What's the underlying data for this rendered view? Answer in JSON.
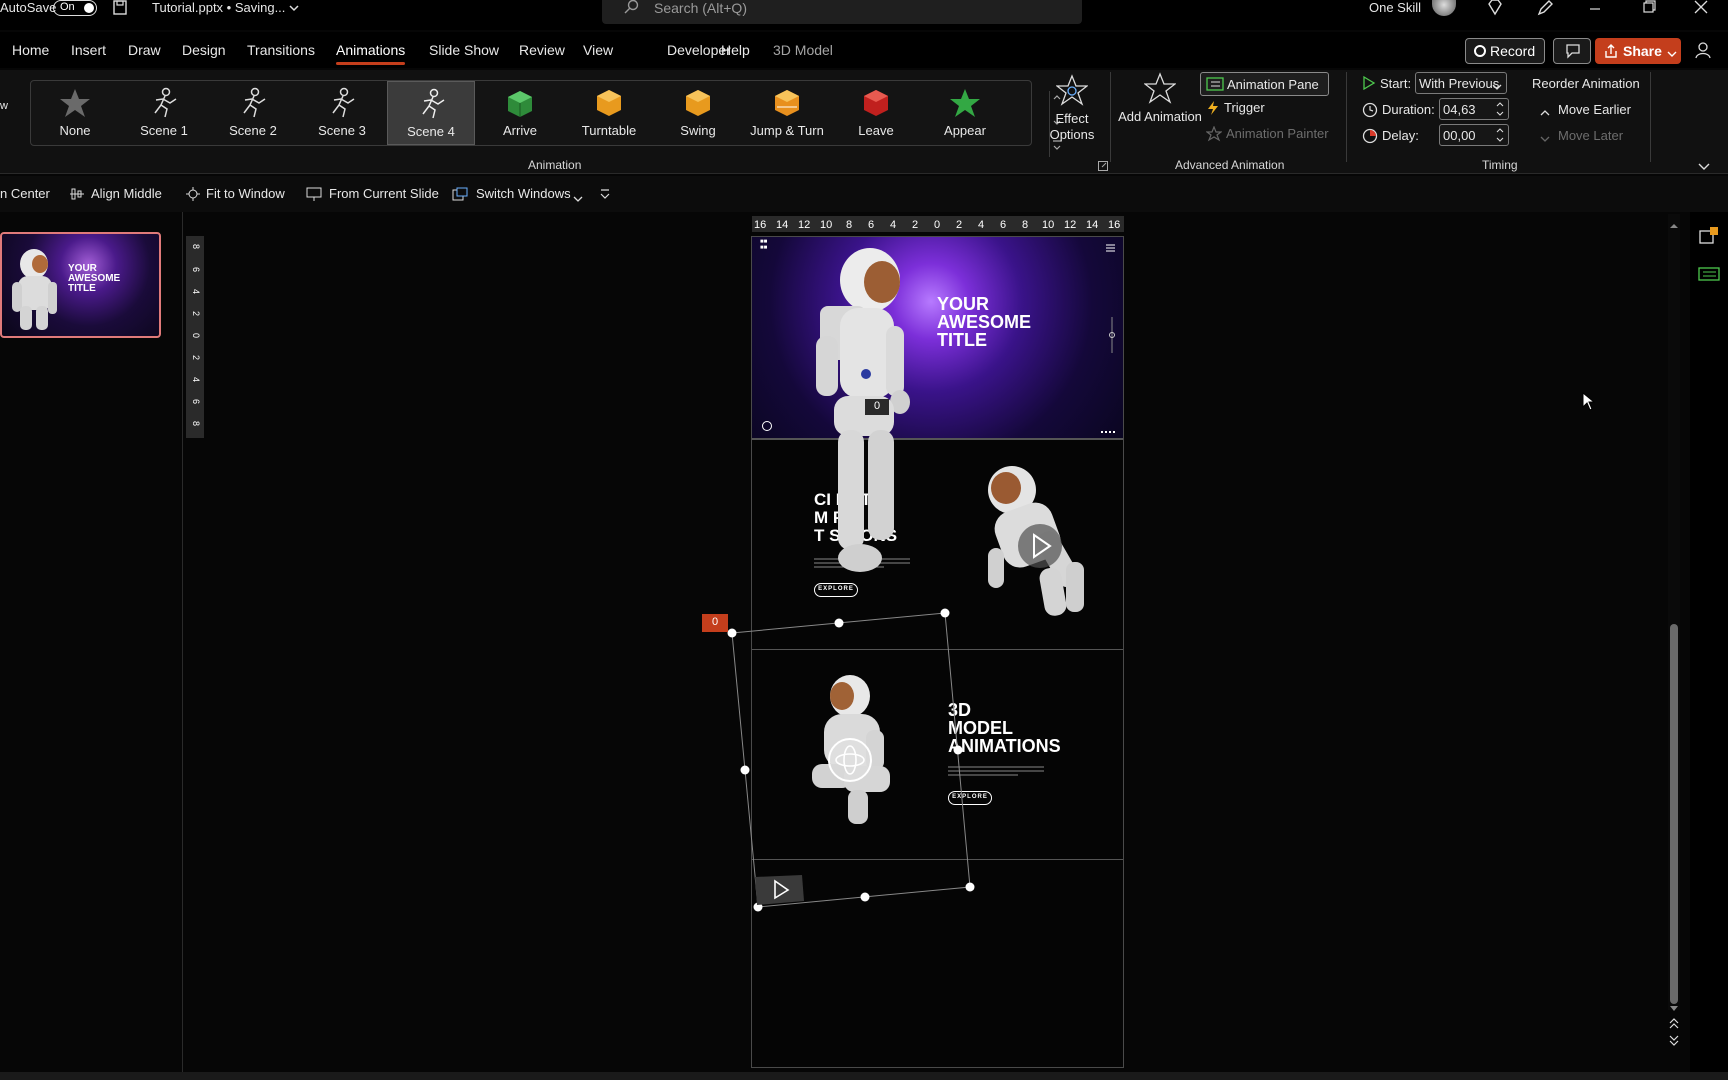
{
  "titlebar": {
    "autosave_label": "AutoSave",
    "autosave_state": "On",
    "file_title": "Tutorial.pptx • Saving...",
    "search_placeholder": "Search (Alt+Q)",
    "user_name": "One Skill"
  },
  "menu": {
    "tabs": [
      "Home",
      "Insert",
      "Draw",
      "Design",
      "Transitions",
      "Animations",
      "Slide Show",
      "Review",
      "View",
      "Developer",
      "Help",
      "3D Model"
    ],
    "active_tab": "Animations",
    "record_label": "Record",
    "share_label": "Share"
  },
  "ribbon": {
    "animation_gallery": [
      "None",
      "Scene 1",
      "Scene 2",
      "Scene 3",
      "Scene 4",
      "Arrive",
      "Turntable",
      "Swing",
      "Jump & Turn",
      "Leave",
      "Appear"
    ],
    "selected_animation": "Scene 4",
    "effect_options": "Effect Options",
    "animation_group_label": "Animation",
    "add_animation": "Add Animation",
    "animation_pane": "Animation Pane",
    "trigger": "Trigger",
    "animation_painter": "Animation Painter",
    "advanced_group_label": "Advanced Animation",
    "start_label": "Start:",
    "start_value": "With Previous",
    "duration_label": "Duration:",
    "duration_value": "04,63",
    "delay_label": "Delay:",
    "delay_value": "00,00",
    "timing_group_label": "Timing",
    "reorder_label": "Reorder Animation",
    "move_earlier": "Move Earlier",
    "move_later": "Move Later"
  },
  "quick_toolbar": {
    "items": [
      "n Center",
      "Align Middle",
      "Fit to Window",
      "From Current Slide",
      "Switch Windows"
    ]
  },
  "thumbnail": {
    "title": "YOUR AWESOME TITLE"
  },
  "ruler": {
    "h_ticks": [
      "16",
      "14",
      "12",
      "10",
      "8",
      "6",
      "4",
      "2",
      "0",
      "2",
      "4",
      "6",
      "8",
      "10",
      "12",
      "14",
      "16"
    ],
    "v_ticks": [
      "8",
      "6",
      "4",
      "2",
      "0",
      "2",
      "4",
      "6",
      "8"
    ]
  },
  "slide": {
    "panel1_title": "YOUR AWESOME TITLE",
    "panel2_title_lines": [
      "CI   MATIC",
      "M   PH",
      "T   SITIONS"
    ],
    "panel3_title_lines": [
      "3D",
      "MODEL",
      "ANIMATIONS"
    ],
    "explore": "EXPLORE",
    "badge_red": "0",
    "badge_dark": "0"
  }
}
